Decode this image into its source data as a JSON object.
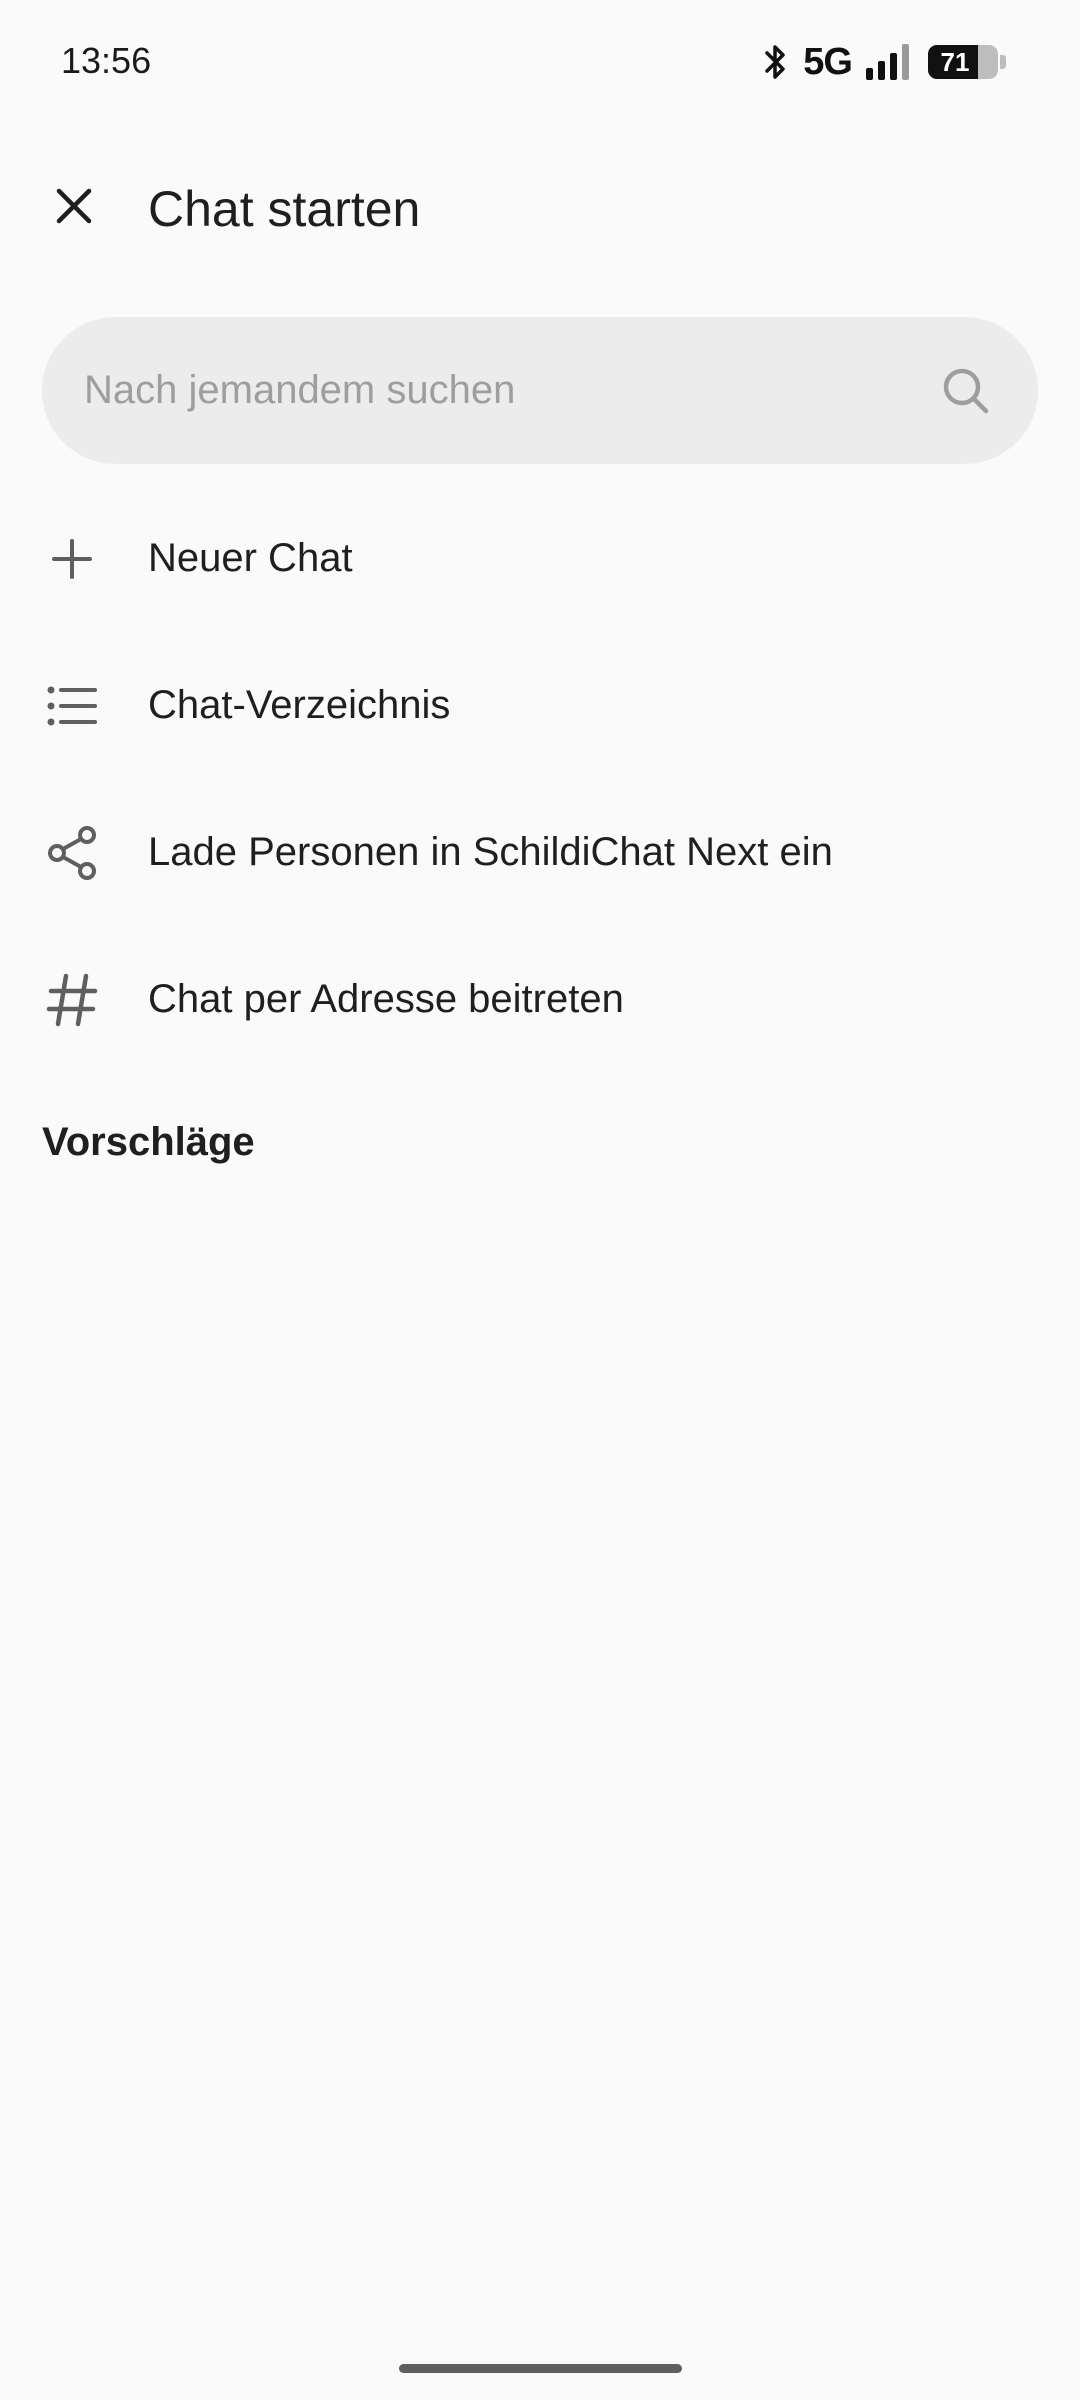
{
  "status_bar": {
    "time": "13:56",
    "network": "5G",
    "battery_level": "71",
    "battery_percent": 71,
    "icons": [
      "bluetooth-icon",
      "signal-icon",
      "battery-icon"
    ]
  },
  "header": {
    "title": "Chat starten",
    "close_icon": "close-icon"
  },
  "search": {
    "placeholder": "Nach jemandem suchen",
    "value": "",
    "icon": "search-icon"
  },
  "menu": {
    "items": [
      {
        "label": "Neuer Chat",
        "icon": "plus-icon"
      },
      {
        "label": "Chat-Verzeichnis",
        "icon": "list-icon"
      },
      {
        "label": "Lade Personen in SchildiChat Next ein",
        "icon": "share-icon"
      },
      {
        "label": "Chat per Adresse beitreten",
        "icon": "hashtag-icon"
      }
    ]
  },
  "suggestions": {
    "title": "Vorschläge"
  },
  "colors": {
    "background": "#fafafa",
    "search_background": "#ececec",
    "text": "#1f1f1f",
    "icon": "#5f5f5f",
    "placeholder": "#9e9e9e"
  }
}
